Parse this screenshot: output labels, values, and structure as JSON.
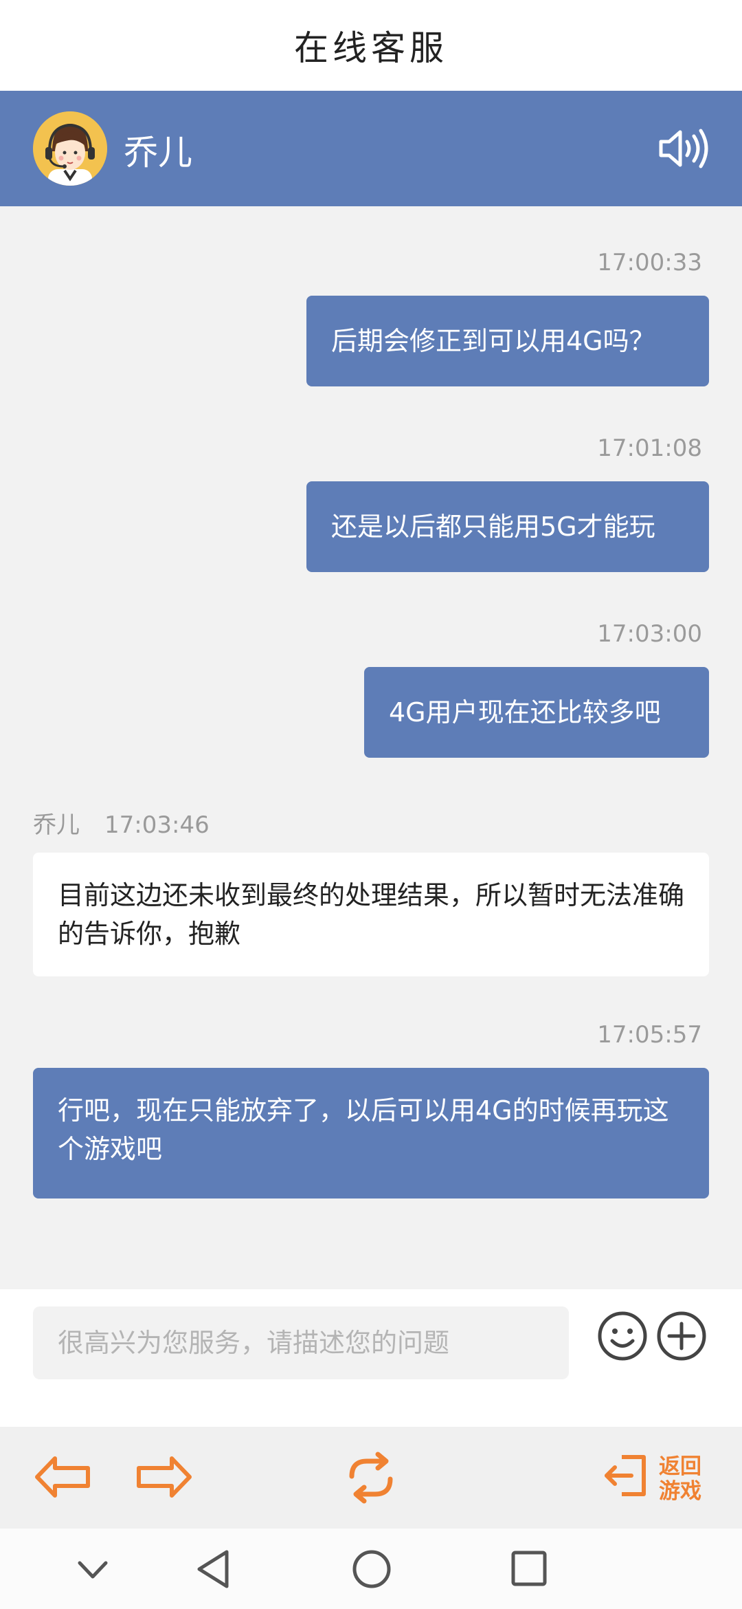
{
  "header": {
    "title": "在线客服"
  },
  "agent": {
    "name": "乔儿",
    "speaker_icon": "speaker-icon"
  },
  "messages": [
    {
      "direction": "out",
      "time": "17:00:33",
      "text": "后期会修正到可以用4G吗？"
    },
    {
      "direction": "out",
      "time": "17:01:08",
      "text": "还是以后都只能用5G才能玩"
    },
    {
      "direction": "out",
      "time": "17:03:00",
      "text": "4G用户现在还比较多吧"
    },
    {
      "direction": "in",
      "sender": "乔儿",
      "time": "17:03:46",
      "text": "目前这边还未收到最终的处理结果，所以暂时无法准确的告诉你，抱歉"
    },
    {
      "direction": "out",
      "time": "17:05:57",
      "text": "行吧，现在只能放弃了，以后可以用4G的时候再玩这个游戏吧"
    }
  ],
  "input": {
    "placeholder": "很高兴为您服务，请描述您的问题"
  },
  "nav": {
    "return_label_line1": "返回",
    "return_label_line2": "游戏"
  },
  "colors": {
    "accent_blue": "#5e7db7",
    "nav_orange": "#f08232",
    "background": "#f2f2f2"
  }
}
